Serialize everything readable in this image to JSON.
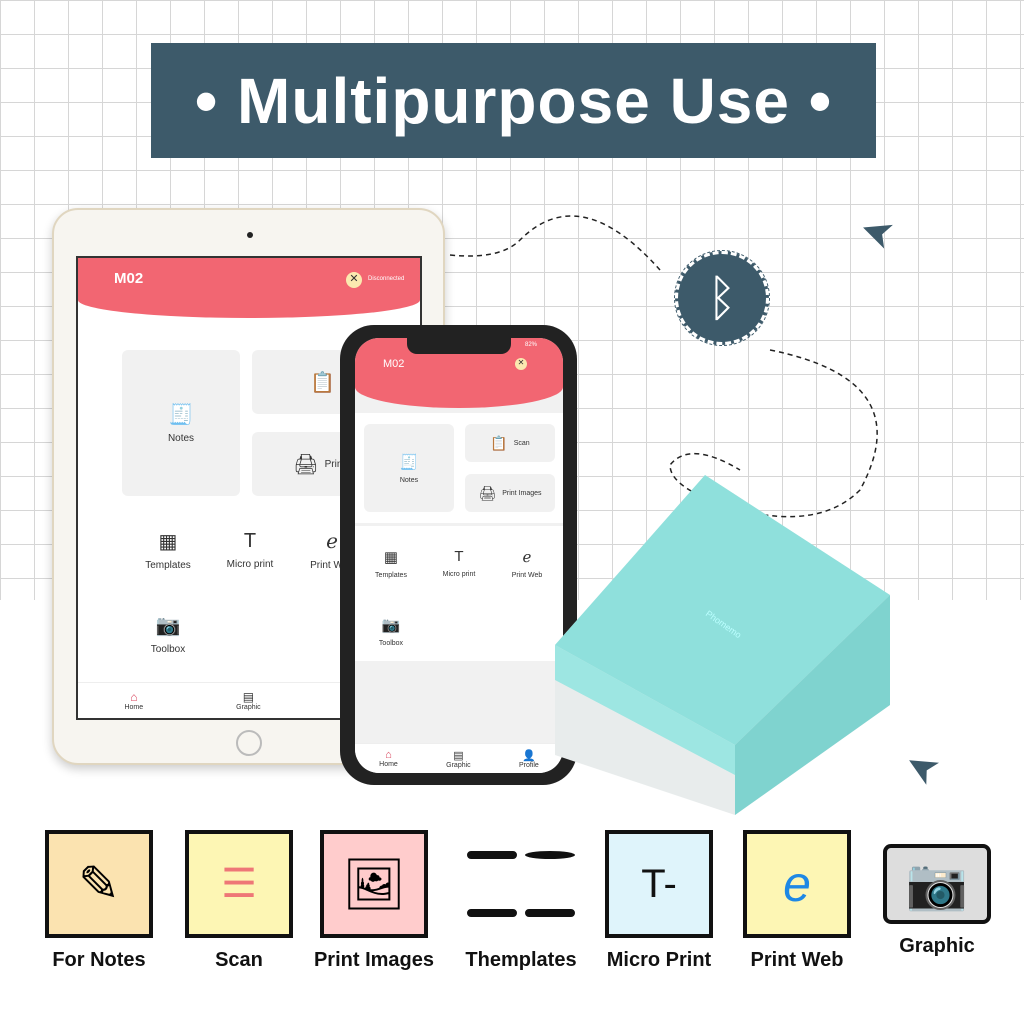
{
  "banner": {
    "title": "• Multipurpose Use •"
  },
  "app": {
    "device": "M02",
    "status": "Disconnected",
    "battery": "82%",
    "cards": [
      "Notes",
      "Scan",
      "Print Images"
    ],
    "tools": [
      "Templates",
      "Micro print",
      "Print Web",
      "Toolbox"
    ],
    "nav": [
      "Home",
      "Graphic",
      "Profile"
    ]
  },
  "printer": {
    "brand": "Phomemo",
    "color": "#8fe0dc"
  },
  "features": [
    "For Notes",
    "Scan",
    "Print Images",
    "Themplates",
    "Micro Print",
    "Print Web",
    "Graphic"
  ],
  "colors": {
    "banner": "#3d5a6a",
    "header": "#f26672"
  }
}
